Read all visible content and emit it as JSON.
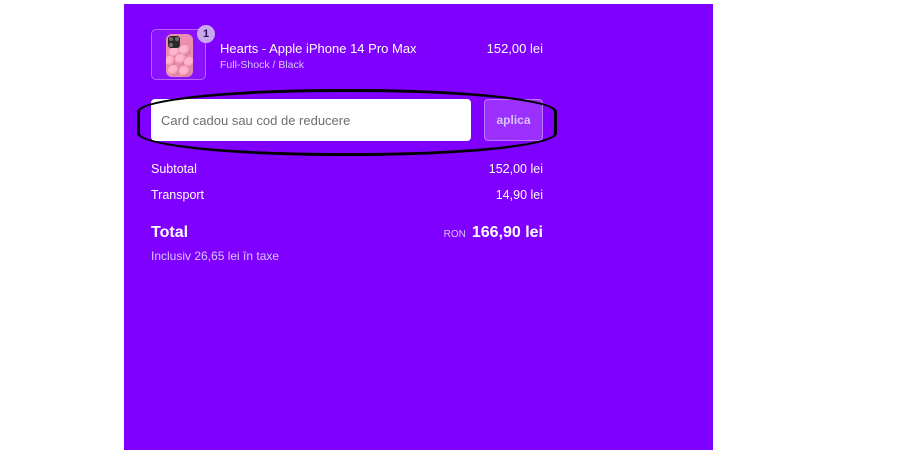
{
  "product": {
    "quantity": "1",
    "title": "Hearts - Apple iPhone 14 Pro Max",
    "variant": "Full-Shock / Black",
    "price": "152,00 lei",
    "image_icon": "phone-case-hearts-thumbnail"
  },
  "discount": {
    "placeholder": "Card cadou sau cod de reducere",
    "value": "",
    "apply_label": "aplica"
  },
  "summary": {
    "subtotal_label": "Subtotal",
    "subtotal_value": "152,00 lei",
    "shipping_label": "Transport",
    "shipping_value": "14,90 lei",
    "total_label": "Total",
    "total_currency": "RON",
    "total_value": "166,90 lei",
    "taxes_note": "Inclusiv 26,65 lei în taxe"
  },
  "colors": {
    "panel_background": "#8000ff",
    "apply_button": "#9b30ff",
    "annotation_outline": "#000000"
  }
}
